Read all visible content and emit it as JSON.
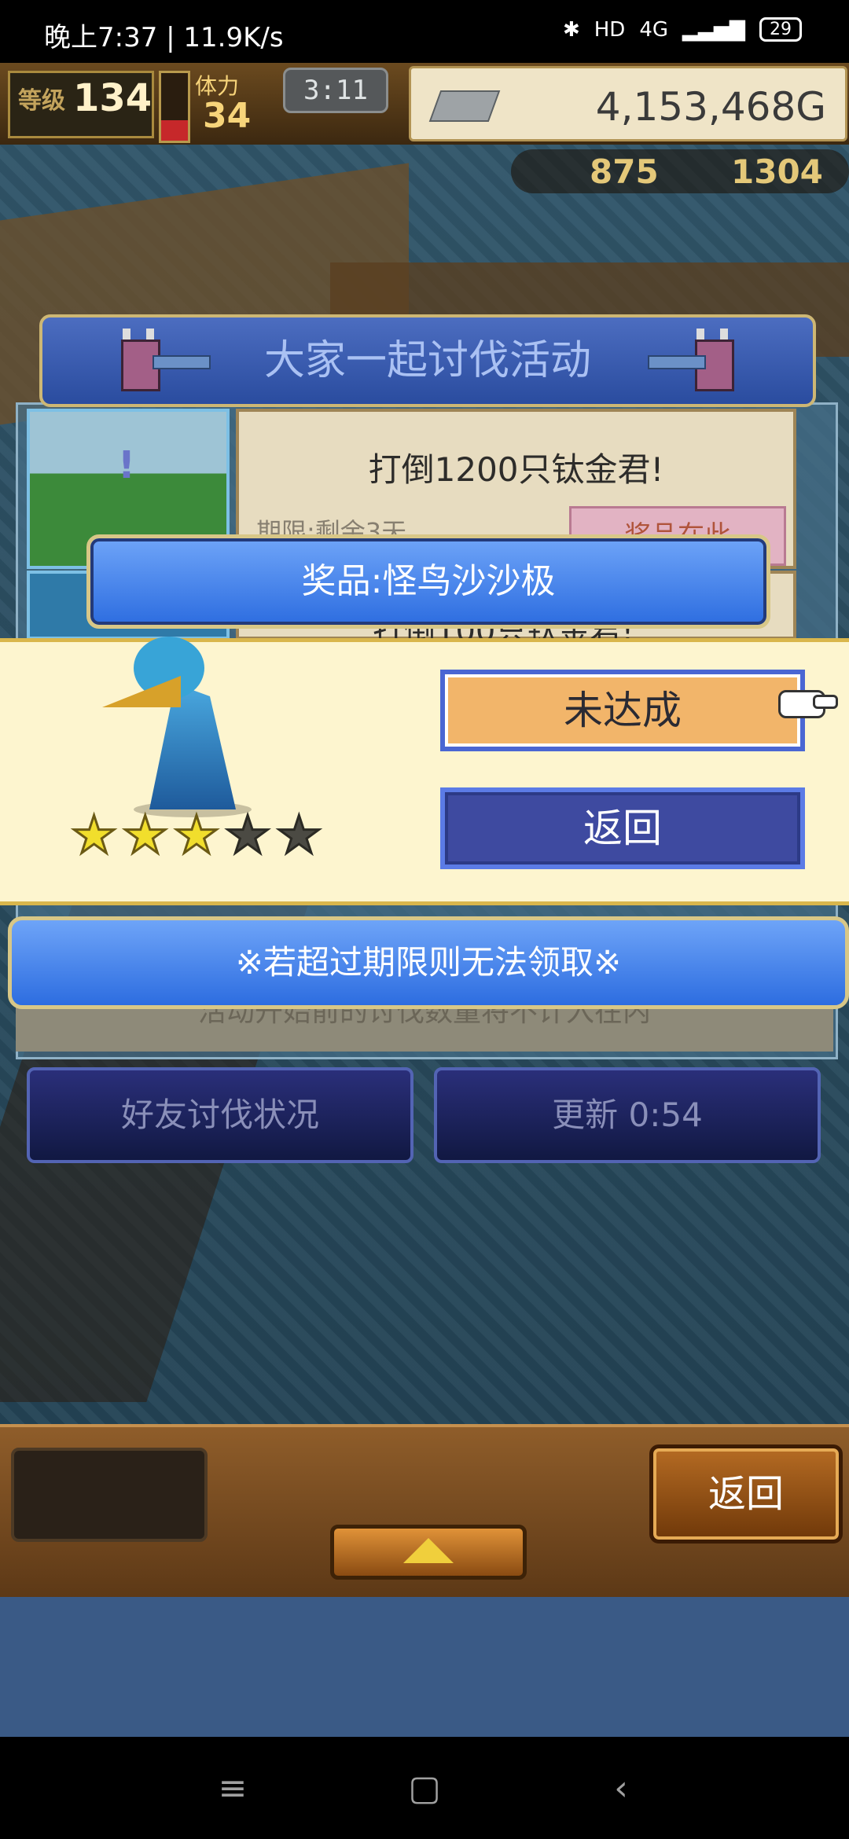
{
  "status_bar": {
    "left_text": "晚上7:37 | 11.9K/s",
    "network": "4G",
    "hd": "HD",
    "battery": "29"
  },
  "hud": {
    "level_label": "等级",
    "level": "134",
    "stamina_label": "体力",
    "stamina": "34",
    "stamina_level": 0.3,
    "timer": "3:11",
    "gold": "4,153,468G",
    "resource_1": "875",
    "resource_2": "1304"
  },
  "event": {
    "title": "大家一起讨伐活动",
    "mission_title": "打倒1200只钛金君!",
    "mission_deadline": "期限:剩余3天",
    "mission_button": "奖品在此",
    "mission2_title": "打倒100只钛金君!",
    "thumb_mark": "!"
  },
  "reward": {
    "title": "奖品:怪鸟沙沙极",
    "rarity": 3,
    "rarity_max": 5,
    "status_button": "未达成",
    "back_button": "返回"
  },
  "notice": {
    "text": "※若超过期限则无法领取※",
    "under_text": "活动开始前的讨伐数量将不计入在内"
  },
  "actions": {
    "friends_button": "好友讨伐状况",
    "refresh_button": "更新 0:54"
  },
  "bottom": {
    "back_button": "返回"
  },
  "nav": {
    "menu": "≡",
    "home": "▢",
    "back": "‹"
  }
}
